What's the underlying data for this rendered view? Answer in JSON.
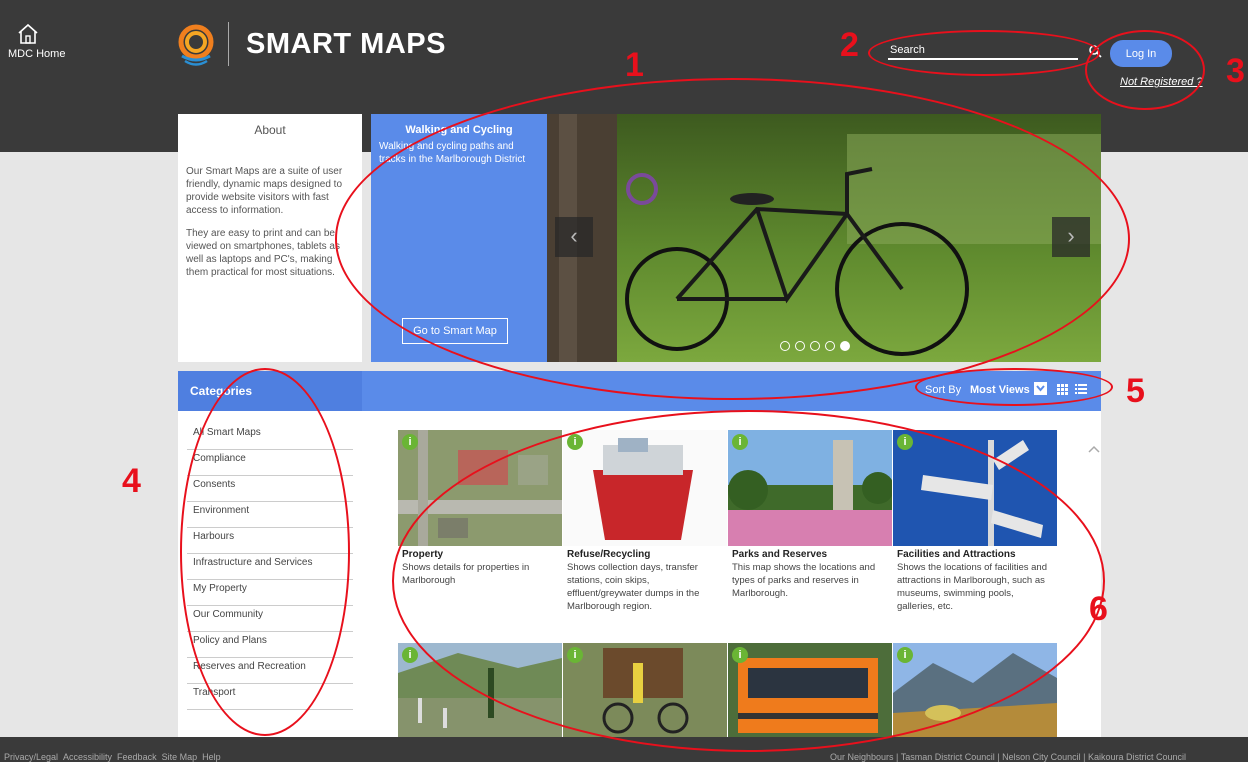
{
  "header": {
    "home_label": "MDC Home",
    "brand": "SMART MAPS",
    "search_placeholder": "Search",
    "login_label": "Log In",
    "not_registered": "Not Registered ?"
  },
  "about": {
    "title": "About",
    "para1": "Our Smart Maps are a suite of user friendly, dynamic maps designed to provide website visitors with fast access to information.",
    "para2": "They are easy to print and can be viewed on smartphones, tablets as well as laptops and PC's, making them practical for most situations."
  },
  "carousel": {
    "title": "Walking and Cycling",
    "description": "Walking and cycling paths and tracks in the Marlborough District",
    "cta": "Go to Smart Map",
    "prev": "‹",
    "next": "›",
    "slide_count": 5,
    "active_slide": 5
  },
  "categories": {
    "heading": "Categories",
    "items": [
      "All Smart Maps",
      "Compliance",
      "Consents",
      "Environment",
      "Harbours",
      "Infrastructure and Services",
      "My Property",
      "Our Community",
      "Policy and Plans",
      "Reserves and Recreation",
      "Transport"
    ]
  },
  "sort": {
    "label": "Sort By",
    "value": "Most Views"
  },
  "cards": [
    {
      "title": "Property",
      "desc": "Shows details for properties in Marlborough"
    },
    {
      "title": "Refuse/Recycling",
      "desc": "Shows collection days, transfer stations, coin skips, effluent/greywater dumps in the Marlborough region."
    },
    {
      "title": "Parks and Reserves",
      "desc": "This map shows the locations and types of parks and reserves in Marlborough."
    },
    {
      "title": "Facilities and Attractions",
      "desc": "Shows the locations of facilities and attractions in Marlborough, such as museums, swimming pools, galleries, etc."
    }
  ],
  "card_info_icon": "i",
  "footer": {
    "left": [
      "Privacy/Legal",
      "Accessibility",
      "Feedback",
      "Site Map",
      "Help"
    ],
    "right": "Our Neighbours  |  Tasman District Council  |  Nelson City Council  |  Kaikoura District Council"
  },
  "annotations": [
    "1",
    "2",
    "3",
    "4",
    "5",
    "6"
  ],
  "colors": {
    "accent": "#5a8be9",
    "header": "#3a3a3a",
    "annotation": "#e8101c",
    "info": "#6ab535"
  }
}
